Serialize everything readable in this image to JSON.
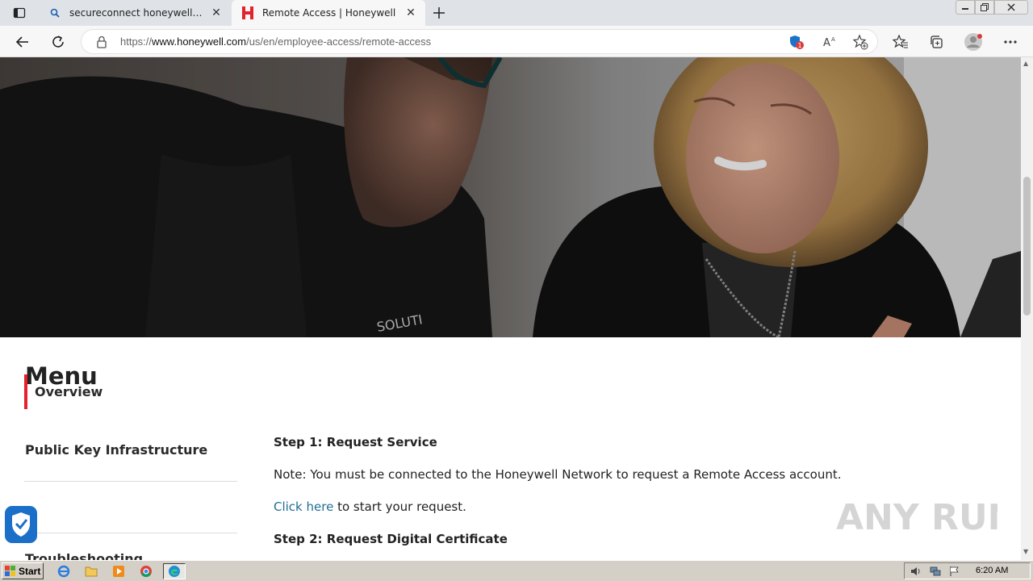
{
  "browser": {
    "tabs": [
      {
        "title": "secureconnect honeywellcloud -",
        "favicon": "search-icon",
        "active": false
      },
      {
        "title": "Remote Access | Honeywell",
        "favicon": "honeywell-h-icon",
        "active": true
      }
    ],
    "address": {
      "scheme": "https://",
      "host": "www.honeywell.com",
      "path": "/us/en/employee-access/remote-access"
    },
    "tracking_badge_count": "1"
  },
  "page": {
    "menu_heading": "Menu",
    "sidebar": {
      "items": [
        {
          "label": "Overview",
          "active": true
        },
        {
          "label": "Public Key Infrastructure",
          "active": false
        },
        {
          "label": "Troubleshooting",
          "active": false
        }
      ]
    },
    "content": {
      "step1_title": "Step 1: Request Service",
      "note": "Note: You must be connected to the Honeywell Network to request a Remote Access account.",
      "link_text": "Click here",
      "link_suffix": " to start your request.",
      "step2_title": "Step 2: Request Digital Certificate"
    },
    "accent_color": "#e4222d",
    "link_color": "#1f6f93"
  },
  "watermark_text": "ANY RUN",
  "taskbar": {
    "start_label": "Start",
    "clock": "6:20 AM"
  }
}
